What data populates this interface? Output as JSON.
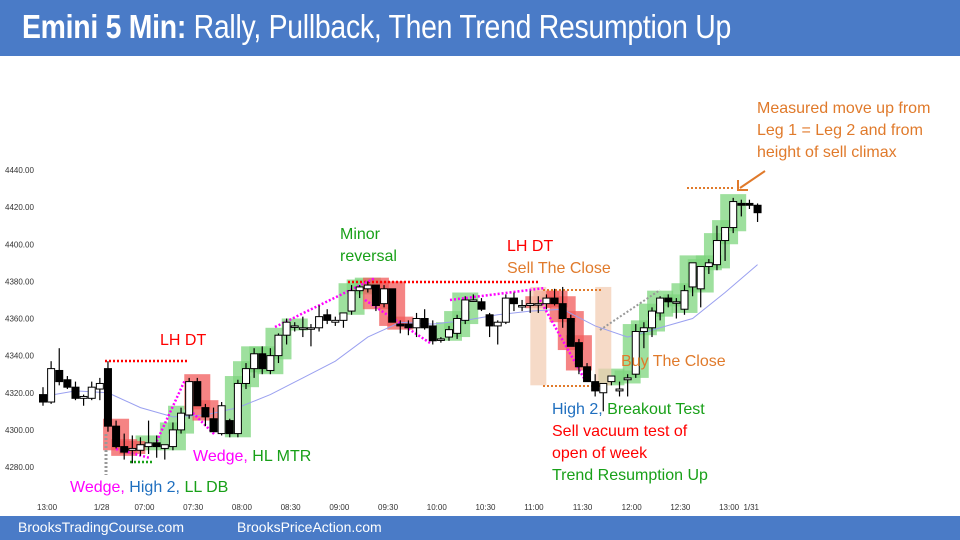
{
  "header": {
    "title_bold": "Emini 5 Min:",
    "title_rest": " Rally, Pullback, Then Trend Resumption Up"
  },
  "footer": {
    "link1": "BrooksTradingCourse.com",
    "link2": "BrooksPriceAction.com"
  },
  "colors": {
    "header_bg": "#4a7bc7",
    "bull_box": "#7ed67e",
    "bear_box": "#f25b5b",
    "neutral_box": "#f3cdb4",
    "magenta": "#ff00ff",
    "orange": "#e07a2b",
    "red": "#ff0000",
    "green": "#18a018",
    "blue": "#1f6fbf",
    "ema": "#9aa0f0"
  },
  "annotations": {
    "lh_dt_1": "LH DT",
    "wedge_hl_mtr_a": "Wedge,",
    "wedge_hl_mtr_b": " HL MTR",
    "wedge_high2_a": "Wedge,",
    "wedge_high2_b": " High 2,",
    "wedge_high2_c": " LL DB",
    "minor_reversal_1": "Minor",
    "minor_reversal_2": "reversal",
    "lh_dt_2": "LH DT",
    "sell_the_close": "Sell The Close",
    "buy_the_close": "Buy The Close",
    "high2_a": "High 2,",
    "high2_b": " Breakout Test",
    "sell_vacuum_1": "Sell vacuum test of",
    "sell_vacuum_2": "open of week",
    "trend_resumption": "Trend Resumption Up",
    "measured_1": "Measured move up from",
    "measured_2": "Leg 1 = Leg 2 and from",
    "measured_3": "height of sell climax"
  },
  "chart_data": {
    "type": "candlestick",
    "title": "Emini 5 Min: Rally, Pullback, Then Trend Resumption Up",
    "ylim": [
      4270,
      4450
    ],
    "y_ticks": [
      "4440.00",
      "4420.00",
      "4400.00",
      "4380.00",
      "4360.00",
      "4340.00",
      "4320.00",
      "4300.00",
      "4280.00"
    ],
    "x_ticks": [
      {
        "label": "13:00",
        "bar": 0
      },
      {
        "label": "1/28",
        "bar": 7
      },
      {
        "label": "07:00",
        "bar": 12
      },
      {
        "label": "07:30",
        "bar": 18
      },
      {
        "label": "08:00",
        "bar": 24
      },
      {
        "label": "08:30",
        "bar": 30
      },
      {
        "label": "09:00",
        "bar": 36
      },
      {
        "label": "09:30",
        "bar": 42
      },
      {
        "label": "10:00",
        "bar": 48
      },
      {
        "label": "10:30",
        "bar": 54
      },
      {
        "label": "11:00",
        "bar": 60
      },
      {
        "label": "11:30",
        "bar": 66
      },
      {
        "label": "12:00",
        "bar": 72
      },
      {
        "label": "12:30",
        "bar": 78
      },
      {
        "label": "13:00",
        "bar": 84
      },
      {
        "label": "1/31",
        "bar": 87
      }
    ],
    "ohlc": [
      [
        4319,
        4323,
        4313,
        4315
      ],
      [
        4315,
        4337,
        4314,
        4333
      ],
      [
        4332,
        4344,
        4324,
        4326
      ],
      [
        4327,
        4329,
        4322,
        4323
      ],
      [
        4323,
        4326,
        4316,
        4317
      ],
      [
        4317,
        4319,
        4313,
        4318
      ],
      [
        4317,
        4326,
        4316,
        4323
      ],
      [
        4322,
        4328,
        4316,
        4325
      ],
      [
        4333,
        4337,
        4299,
        4302
      ],
      [
        4302,
        4305,
        4290,
        4291
      ],
      [
        4291,
        4298,
        4284,
        4288
      ],
      [
        4289,
        4297,
        4282,
        4290
      ],
      [
        4289,
        4296,
        4286,
        4292
      ],
      [
        4291,
        4305,
        4287,
        4293
      ],
      [
        4293,
        4297,
        4285,
        4291
      ],
      [
        4290,
        4292,
        4284,
        4292
      ],
      [
        4291,
        4304,
        4289,
        4300
      ],
      [
        4300,
        4312,
        4298,
        4309
      ],
      [
        4308,
        4328,
        4306,
        4326
      ],
      [
        4326,
        4328,
        4315,
        4313
      ],
      [
        4312,
        4314,
        4302,
        4307
      ],
      [
        4306,
        4312,
        4300,
        4299
      ],
      [
        4298,
        4315,
        4297,
        4313
      ],
      [
        4305,
        4306,
        4296,
        4298
      ],
      [
        4298,
        4327,
        4296,
        4325
      ],
      [
        4325,
        4336,
        4322,
        4333
      ],
      [
        4333,
        4344,
        4328,
        4341
      ],
      [
        4341,
        4345,
        4330,
        4333
      ],
      [
        4332,
        4344,
        4330,
        4340
      ],
      [
        4340,
        4352,
        4336,
        4351
      ],
      [
        4351,
        4360,
        4346,
        4358
      ],
      [
        4356,
        4358,
        4353,
        4356
      ],
      [
        4355,
        4361,
        4350,
        4355
      ],
      [
        4355,
        4357,
        4345,
        4355
      ],
      [
        4355,
        4367,
        4353,
        4361
      ],
      [
        4362,
        4365,
        4357,
        4359
      ],
      [
        4358,
        4361,
        4356,
        4359
      ],
      [
        4359,
        4363,
        4355,
        4363
      ],
      [
        4364,
        4378,
        4362,
        4375
      ],
      [
        4375,
        4378,
        4371,
        4377
      ],
      [
        4376,
        4380,
        4374,
        4378
      ],
      [
        4378,
        4378,
        4364,
        4367
      ],
      [
        4368,
        4378,
        4366,
        4376
      ],
      [
        4376,
        4376,
        4361,
        4358
      ],
      [
        4357,
        4359,
        4352,
        4356
      ],
      [
        4357,
        4359,
        4351,
        4355
      ],
      [
        4355,
        4363,
        4350,
        4360
      ],
      [
        4360,
        4365,
        4354,
        4355
      ],
      [
        4356,
        4359,
        4346,
        4348
      ],
      [
        4349,
        4350,
        4347,
        4349
      ],
      [
        4350,
        4356,
        4348,
        4354
      ],
      [
        4352,
        4362,
        4349,
        4360
      ],
      [
        4359,
        4372,
        4357,
        4370
      ],
      [
        4370,
        4373,
        4369,
        4370
      ],
      [
        4369,
        4371,
        4364,
        4365
      ],
      [
        4362,
        4363,
        4350,
        4356
      ],
      [
        4356,
        4359,
        4346,
        4358
      ],
      [
        4358,
        4373,
        4357,
        4371
      ],
      [
        4371,
        4374,
        4364,
        4368
      ],
      [
        4367,
        4370,
        4364,
        4367
      ],
      [
        4367,
        4375,
        4363,
        4368
      ],
      [
        4368,
        4372,
        4363,
        4368
      ],
      [
        4368,
        4373,
        4365,
        4371
      ],
      [
        4371,
        4376,
        4367,
        4368
      ],
      [
        4368,
        4377,
        4355,
        4360
      ],
      [
        4360,
        4362,
        4345,
        4345
      ],
      [
        4347,
        4349,
        4330,
        4334
      ],
      [
        4334,
        4336,
        4326,
        4326
      ],
      [
        4326,
        4330,
        4318,
        4321
      ],
      [
        4320,
        4325,
        4310,
        4325
      ],
      [
        4326,
        4328,
        4324,
        4329
      ],
      [
        4321,
        4326,
        4318,
        4322
      ],
      [
        4327,
        4330,
        4318,
        4328
      ],
      [
        4330,
        4357,
        4328,
        4353
      ],
      [
        4353,
        4358,
        4344,
        4355
      ],
      [
        4355,
        4366,
        4350,
        4364
      ],
      [
        4363,
        4372,
        4359,
        4371
      ],
      [
        4371,
        4373,
        4366,
        4369
      ],
      [
        4369,
        4371,
        4360,
        4369
      ],
      [
        4365,
        4378,
        4362,
        4375
      ],
      [
        4377,
        4386,
        4372,
        4390
      ],
      [
        4376,
        4384,
        4366,
        4388
      ],
      [
        4388,
        4392,
        4384,
        4390
      ],
      [
        4389,
        4410,
        4386,
        4402
      ],
      [
        4402,
        4409,
        4391,
        4409
      ],
      [
        4409,
        4425,
        4406,
        4423
      ],
      [
        4422,
        4424,
        4415,
        4421
      ],
      [
        4422,
        4424,
        4419,
        4421
      ],
      [
        4421,
        4422,
        4412,
        4417
      ]
    ],
    "ema": [
      [
        0,
        4318
      ],
      [
        4,
        4321
      ],
      [
        8,
        4320
      ],
      [
        12,
        4312
      ],
      [
        16,
        4307
      ],
      [
        20,
        4308
      ],
      [
        24,
        4312
      ],
      [
        28,
        4319
      ],
      [
        32,
        4328
      ],
      [
        36,
        4337
      ],
      [
        40,
        4350
      ],
      [
        44,
        4358
      ],
      [
        48,
        4357
      ],
      [
        52,
        4359
      ],
      [
        56,
        4362
      ],
      [
        60,
        4364
      ],
      [
        64,
        4365
      ],
      [
        68,
        4356
      ],
      [
        72,
        4350
      ],
      [
        76,
        4355
      ],
      [
        80,
        4360
      ],
      [
        84,
        4374
      ],
      [
        88,
        4389
      ]
    ],
    "series": [
      {
        "name": "Emini 5 Min OHLC"
      },
      {
        "name": "20-bar EMA"
      }
    ]
  }
}
